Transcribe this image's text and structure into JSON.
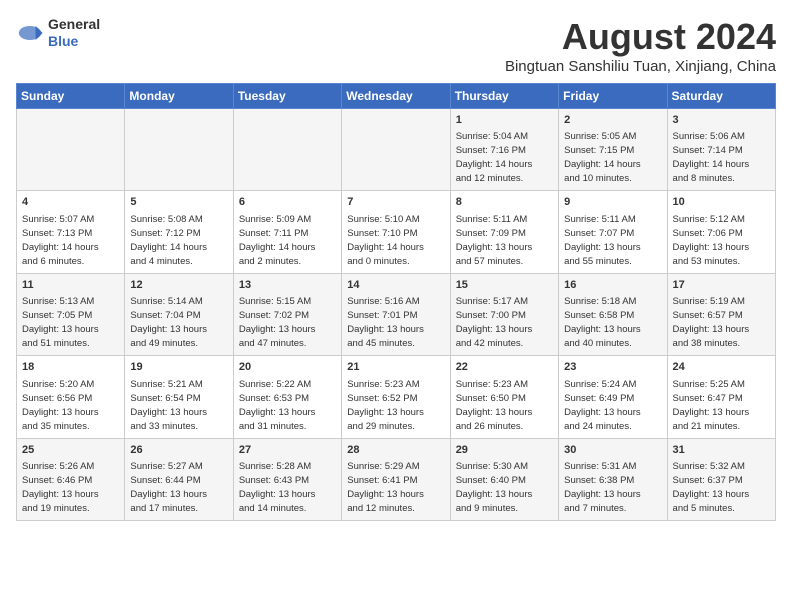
{
  "header": {
    "logo_line1": "General",
    "logo_line2": "Blue",
    "month_year": "August 2024",
    "location": "Bingtuan Sanshiliu Tuan, Xinjiang, China"
  },
  "weekdays": [
    "Sunday",
    "Monday",
    "Tuesday",
    "Wednesday",
    "Thursday",
    "Friday",
    "Saturday"
  ],
  "weeks": [
    [
      {
        "day": "",
        "info": ""
      },
      {
        "day": "",
        "info": ""
      },
      {
        "day": "",
        "info": ""
      },
      {
        "day": "",
        "info": ""
      },
      {
        "day": "1",
        "info": "Sunrise: 5:04 AM\nSunset: 7:16 PM\nDaylight: 14 hours\nand 12 minutes."
      },
      {
        "day": "2",
        "info": "Sunrise: 5:05 AM\nSunset: 7:15 PM\nDaylight: 14 hours\nand 10 minutes."
      },
      {
        "day": "3",
        "info": "Sunrise: 5:06 AM\nSunset: 7:14 PM\nDaylight: 14 hours\nand 8 minutes."
      }
    ],
    [
      {
        "day": "4",
        "info": "Sunrise: 5:07 AM\nSunset: 7:13 PM\nDaylight: 14 hours\nand 6 minutes."
      },
      {
        "day": "5",
        "info": "Sunrise: 5:08 AM\nSunset: 7:12 PM\nDaylight: 14 hours\nand 4 minutes."
      },
      {
        "day": "6",
        "info": "Sunrise: 5:09 AM\nSunset: 7:11 PM\nDaylight: 14 hours\nand 2 minutes."
      },
      {
        "day": "7",
        "info": "Sunrise: 5:10 AM\nSunset: 7:10 PM\nDaylight: 14 hours\nand 0 minutes."
      },
      {
        "day": "8",
        "info": "Sunrise: 5:11 AM\nSunset: 7:09 PM\nDaylight: 13 hours\nand 57 minutes."
      },
      {
        "day": "9",
        "info": "Sunrise: 5:11 AM\nSunset: 7:07 PM\nDaylight: 13 hours\nand 55 minutes."
      },
      {
        "day": "10",
        "info": "Sunrise: 5:12 AM\nSunset: 7:06 PM\nDaylight: 13 hours\nand 53 minutes."
      }
    ],
    [
      {
        "day": "11",
        "info": "Sunrise: 5:13 AM\nSunset: 7:05 PM\nDaylight: 13 hours\nand 51 minutes."
      },
      {
        "day": "12",
        "info": "Sunrise: 5:14 AM\nSunset: 7:04 PM\nDaylight: 13 hours\nand 49 minutes."
      },
      {
        "day": "13",
        "info": "Sunrise: 5:15 AM\nSunset: 7:02 PM\nDaylight: 13 hours\nand 47 minutes."
      },
      {
        "day": "14",
        "info": "Sunrise: 5:16 AM\nSunset: 7:01 PM\nDaylight: 13 hours\nand 45 minutes."
      },
      {
        "day": "15",
        "info": "Sunrise: 5:17 AM\nSunset: 7:00 PM\nDaylight: 13 hours\nand 42 minutes."
      },
      {
        "day": "16",
        "info": "Sunrise: 5:18 AM\nSunset: 6:58 PM\nDaylight: 13 hours\nand 40 minutes."
      },
      {
        "day": "17",
        "info": "Sunrise: 5:19 AM\nSunset: 6:57 PM\nDaylight: 13 hours\nand 38 minutes."
      }
    ],
    [
      {
        "day": "18",
        "info": "Sunrise: 5:20 AM\nSunset: 6:56 PM\nDaylight: 13 hours\nand 35 minutes."
      },
      {
        "day": "19",
        "info": "Sunrise: 5:21 AM\nSunset: 6:54 PM\nDaylight: 13 hours\nand 33 minutes."
      },
      {
        "day": "20",
        "info": "Sunrise: 5:22 AM\nSunset: 6:53 PM\nDaylight: 13 hours\nand 31 minutes."
      },
      {
        "day": "21",
        "info": "Sunrise: 5:23 AM\nSunset: 6:52 PM\nDaylight: 13 hours\nand 29 minutes."
      },
      {
        "day": "22",
        "info": "Sunrise: 5:23 AM\nSunset: 6:50 PM\nDaylight: 13 hours\nand 26 minutes."
      },
      {
        "day": "23",
        "info": "Sunrise: 5:24 AM\nSunset: 6:49 PM\nDaylight: 13 hours\nand 24 minutes."
      },
      {
        "day": "24",
        "info": "Sunrise: 5:25 AM\nSunset: 6:47 PM\nDaylight: 13 hours\nand 21 minutes."
      }
    ],
    [
      {
        "day": "25",
        "info": "Sunrise: 5:26 AM\nSunset: 6:46 PM\nDaylight: 13 hours\nand 19 minutes."
      },
      {
        "day": "26",
        "info": "Sunrise: 5:27 AM\nSunset: 6:44 PM\nDaylight: 13 hours\nand 17 minutes."
      },
      {
        "day": "27",
        "info": "Sunrise: 5:28 AM\nSunset: 6:43 PM\nDaylight: 13 hours\nand 14 minutes."
      },
      {
        "day": "28",
        "info": "Sunrise: 5:29 AM\nSunset: 6:41 PM\nDaylight: 13 hours\nand 12 minutes."
      },
      {
        "day": "29",
        "info": "Sunrise: 5:30 AM\nSunset: 6:40 PM\nDaylight: 13 hours\nand 9 minutes."
      },
      {
        "day": "30",
        "info": "Sunrise: 5:31 AM\nSunset: 6:38 PM\nDaylight: 13 hours\nand 7 minutes."
      },
      {
        "day": "31",
        "info": "Sunrise: 5:32 AM\nSunset: 6:37 PM\nDaylight: 13 hours\nand 5 minutes."
      }
    ]
  ]
}
